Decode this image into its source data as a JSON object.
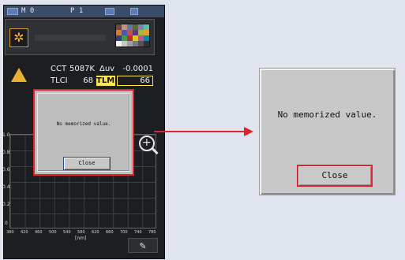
{
  "status": {
    "left": "M 0",
    "mid": "P 1"
  },
  "readouts": {
    "cct_label": "CCT",
    "cct_value": "5087K",
    "duv_label": "Δuv",
    "duv_value": "-0.0001",
    "tlci_label": "TLCI",
    "tlci_value": "68",
    "tlmf_label": "TLMF",
    "tlmf_value": "66"
  },
  "graph": {
    "y_ticks": [
      "1.0",
      "0.8",
      "0.6",
      "0.4",
      "0.2",
      "0"
    ],
    "x_ticks": [
      "380",
      "420",
      "460",
      "500",
      "540",
      "580",
      "620",
      "660",
      "700",
      "740",
      "780"
    ],
    "unit": "[nm]"
  },
  "dialog": {
    "message": "No memorized value.",
    "close_label": "Close"
  },
  "icons": {
    "mode": "sun-icon",
    "zoom": "zoom-icon",
    "tools": "wrench-icon"
  },
  "colors": {
    "accent": "#e0232b",
    "tlmf_highlight": "#ffe54d"
  }
}
